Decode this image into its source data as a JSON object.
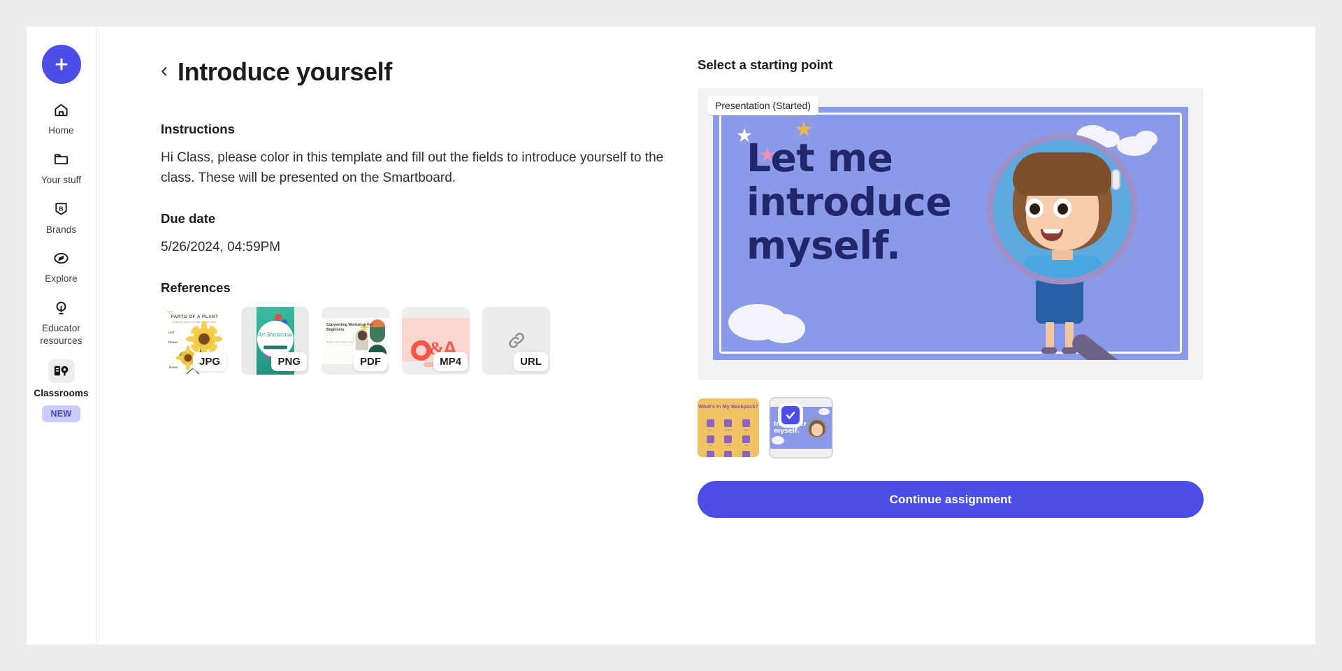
{
  "sidebar": {
    "create_button": {
      "icon": "plus-icon",
      "label": "Create"
    },
    "items": [
      {
        "icon": "home-icon",
        "label": "Home",
        "active": false
      },
      {
        "icon": "folder-icon",
        "label": "Your stuff",
        "active": false
      },
      {
        "icon": "brand-badge-icon",
        "label": "Brands",
        "active": false
      },
      {
        "icon": "compass-icon",
        "label": "Explore",
        "active": false
      },
      {
        "icon": "lightbulb-icon",
        "label": "Educator resources",
        "active": false
      },
      {
        "icon": "classrooms-icon",
        "label": "Classrooms",
        "active": true
      }
    ],
    "new_badge": "NEW"
  },
  "assignment": {
    "back_chevron": "‹",
    "title": "Introduce yourself",
    "instructions_heading": "Instructions",
    "instructions_body": "Hi Class, please color in this template and fill out the fields to introduce yourself to the class. These will be presented on the Smartboard.",
    "due_date_heading": "Due date",
    "due_date_value": "5/26/2024, 04:59PM",
    "references_heading": "References",
    "references": [
      {
        "type": "JPG",
        "icon": "image-file-icon",
        "preview_title": "PARTS OF A PLANT",
        "preview_subtitle": "Write the parts of the plant in order below",
        "preview_top_note": "Name",
        "preview_labels": [
          "Leaf",
          "Flower",
          "Roots"
        ]
      },
      {
        "type": "PNG",
        "icon": "image-file-icon",
        "preview_title": "Art Showcase"
      },
      {
        "type": "PDF",
        "icon": "document-file-icon",
        "preview_title": "Copywriting Workshop For Beginners",
        "preview_subtitle": "Register today\nLimited seats"
      },
      {
        "type": "MP4",
        "icon": "video-file-icon",
        "preview_title": "Q&A"
      },
      {
        "type": "URL",
        "icon": "link-icon",
        "preview_title": ""
      }
    ]
  },
  "starting_point": {
    "heading": "Select a starting point",
    "preview_badge": "Presentation (Started)",
    "slide": {
      "text_lines": [
        "Let me",
        "introduce",
        "myself."
      ],
      "background_color": "#8b9ae8",
      "text_color": "#22276b",
      "illustration": "girl-with-magnifying-glass"
    },
    "thumbnails": [
      {
        "name": "What's In My Backpack?",
        "selected": false,
        "accent": "#f0c263"
      },
      {
        "name": "Let me introduce myself.",
        "selected": true,
        "accent": "#8b9ae8"
      }
    ],
    "continue_label": "Continue assignment"
  },
  "colors": {
    "brand_indigo": "#4d4de8",
    "slide_blue": "#8b9ae8",
    "slide_navy": "#22276b",
    "badge_lavender": "#ccccf8",
    "page_bg": "#ececec"
  }
}
